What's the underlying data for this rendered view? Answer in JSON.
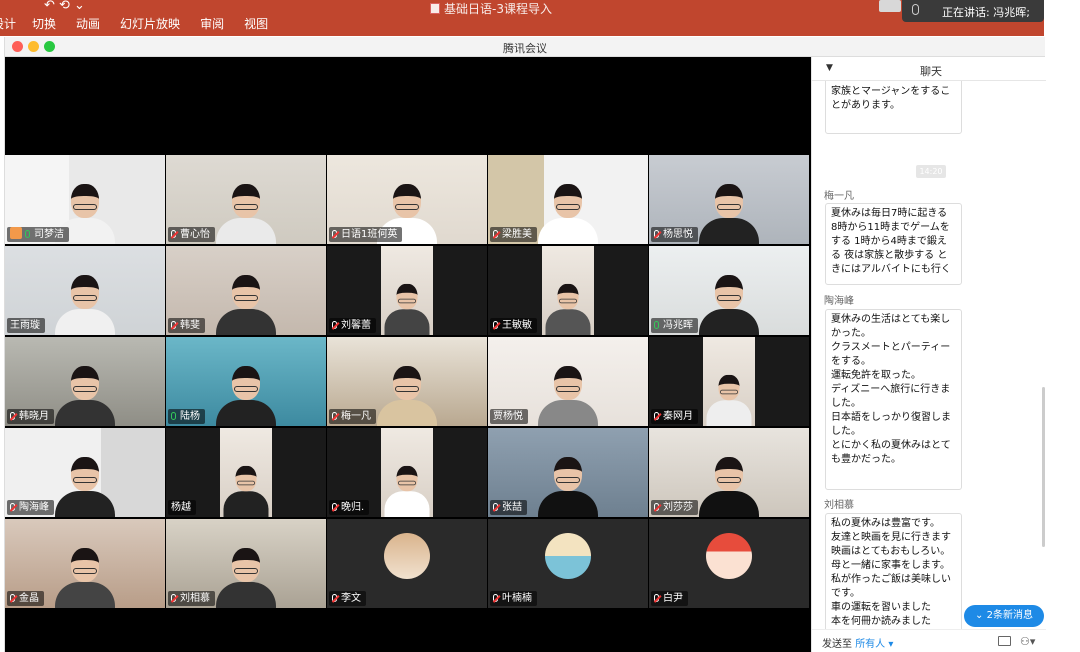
{
  "ppt": {
    "menu": [
      "设计",
      "切换",
      "动画",
      "幻灯片放映",
      "审阅",
      "视图"
    ],
    "doc_title": "基础日语-3课程导入"
  },
  "speaking": {
    "label": "正在讲话: 冯兆晖;"
  },
  "window": {
    "title": "腾讯会议"
  },
  "participants": [
    {
      "name": "司梦洁",
      "mic": "on",
      "host": true
    },
    {
      "name": "曹心怡",
      "mic": "muted"
    },
    {
      "name": "日语1班何英",
      "mic": "muted"
    },
    {
      "name": "梁胜美",
      "mic": "muted"
    },
    {
      "name": "杨思悦",
      "mic": "muted"
    },
    {
      "name": "王雨璇",
      "mic": "none"
    },
    {
      "name": "韩斐",
      "mic": "muted"
    },
    {
      "name": "刘馨蕾",
      "mic": "muted"
    },
    {
      "name": "王敏敏",
      "mic": "muted"
    },
    {
      "name": "冯兆晖",
      "mic": "on",
      "speaking": true
    },
    {
      "name": "韩晓月",
      "mic": "muted"
    },
    {
      "name": "陆杨",
      "mic": "on"
    },
    {
      "name": "梅一凡",
      "mic": "muted"
    },
    {
      "name": "贾杨悦",
      "mic": "none"
    },
    {
      "name": "秦网月",
      "mic": "muted"
    },
    {
      "name": "陶海峰",
      "mic": "muted"
    },
    {
      "name": "杨越",
      "mic": "none"
    },
    {
      "name": "晚归.",
      "mic": "muted"
    },
    {
      "name": "张喆",
      "mic": "muted"
    },
    {
      "name": "刘莎莎",
      "mic": "muted"
    },
    {
      "name": "金晶",
      "mic": "muted"
    },
    {
      "name": "刘相慕",
      "mic": "muted"
    },
    {
      "name": "李文",
      "mic": "muted"
    },
    {
      "name": "叶楠楠",
      "mic": "muted"
    },
    {
      "name": "白尹",
      "mic": "muted"
    }
  ],
  "chat": {
    "title": "聊天",
    "time_chip": "14:20",
    "messages": [
      {
        "sender": "",
        "text": "オリンピックを見ました。\n家族とマージャンをすることがあります。"
      },
      {
        "sender": "梅一凡",
        "text": "夏休みは毎日7時に起きる 8時から11時までゲームをする 1時から4時まで鍛える 夜は家族と散歩する ときにはアルバイトにも行く"
      },
      {
        "sender": "陶海峰",
        "text": "夏休みの生活はとても楽しかった。\nクラスメートとパーティーをする。\n運転免許を取った。\nディズニーへ旅行に行きました。\n日本語をしっかり復習しました。\nとにかく私の夏休みはとても豊かだった。"
      },
      {
        "sender": "刘相慕",
        "text": "私の夏休みは豊富です。\n友達と映画を見に行きます\n映画はとてもおもしろい。\n母と一緒に家事をします。\n私が作ったご飯は美味しいです。\n車の運転を習いました\n本を何冊か読みました\nこの休みは家族や友達と一緒にいて楽しいです。"
      }
    ],
    "new_messages": "2条新消息",
    "send_to_label": "发送至",
    "send_to_target": "所有人"
  }
}
